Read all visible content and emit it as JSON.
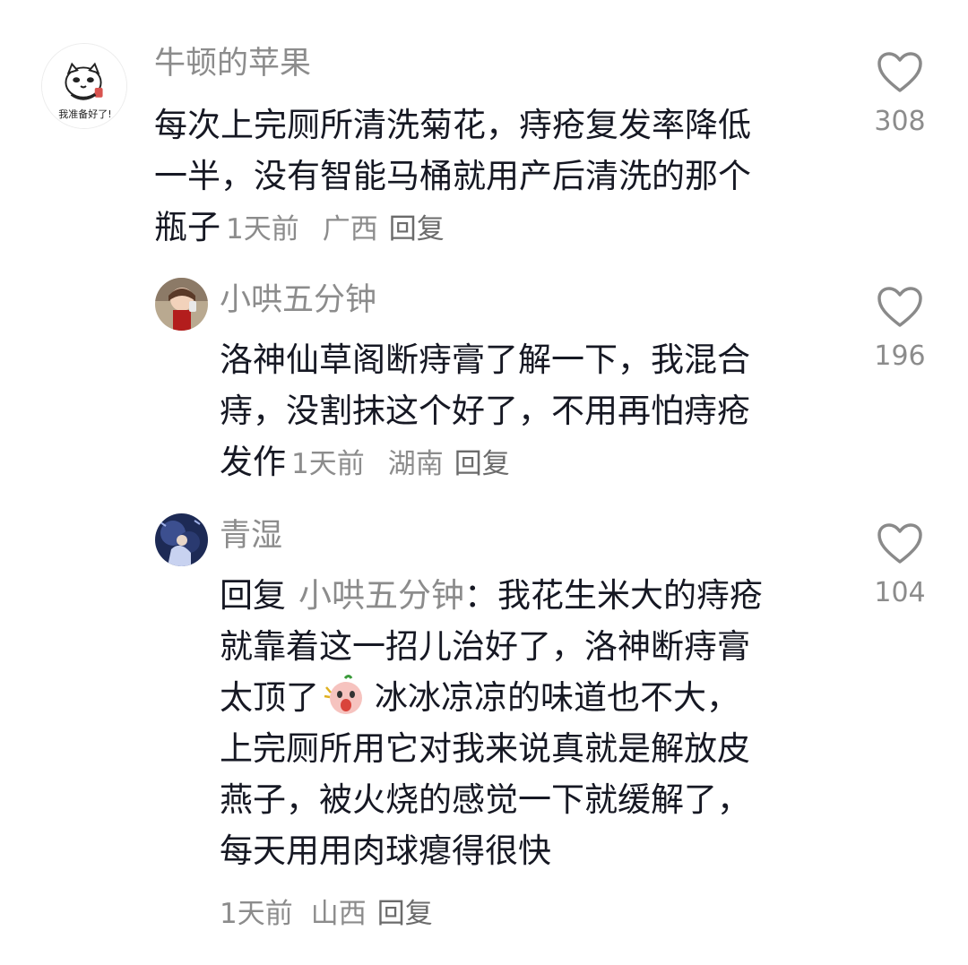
{
  "comments": [
    {
      "username": "牛顿的苹果",
      "avatar_text": "我准备好了!",
      "lines": [
        "每次上完厕所清洗菊花，痔疮复发率降低",
        "一半，没有智能马桶就用产后清洗的那个",
        "瓶子"
      ],
      "time": "1天前",
      "location": "广西",
      "reply_label": "回复",
      "likes": "308"
    },
    {
      "username": "小哄五分钟",
      "lines": [
        "洛神仙草阁断痔膏了解一下，我混合",
        "痔，没割抹这个好了，不用再怕痔疮",
        "发作"
      ],
      "time": "1天前",
      "location": "湖南",
      "reply_label": "回复",
      "likes": "196"
    },
    {
      "username": "青湿",
      "reply_prefix": "回复",
      "reply_target": "小哄五分钟",
      "reply_colon": "：",
      "first_line_text": "我花生米大的痔疮",
      "lines": [
        "就靠着这一招儿治好了，洛神断痔膏",
        "太顶了"
      ],
      "after_emoji_text": "冰冰凉凉的味道也不大，",
      "more_lines": [
        "上完厕所用它对我来说真就是解放皮",
        "燕子，被火烧的感觉一下就缓解了，",
        "每天用用肉球瘪得很快"
      ],
      "time": "1天前",
      "location": "山西",
      "reply_label": "回复",
      "likes": "104",
      "emoji": "shocked-face-emoji"
    }
  ],
  "colors": {
    "text": "#161823",
    "secondary": "#8c8c8c",
    "heart_stroke": "#8a8a8a",
    "background": "#ffffff"
  },
  "icons": {
    "like": "heart-outline-icon"
  }
}
